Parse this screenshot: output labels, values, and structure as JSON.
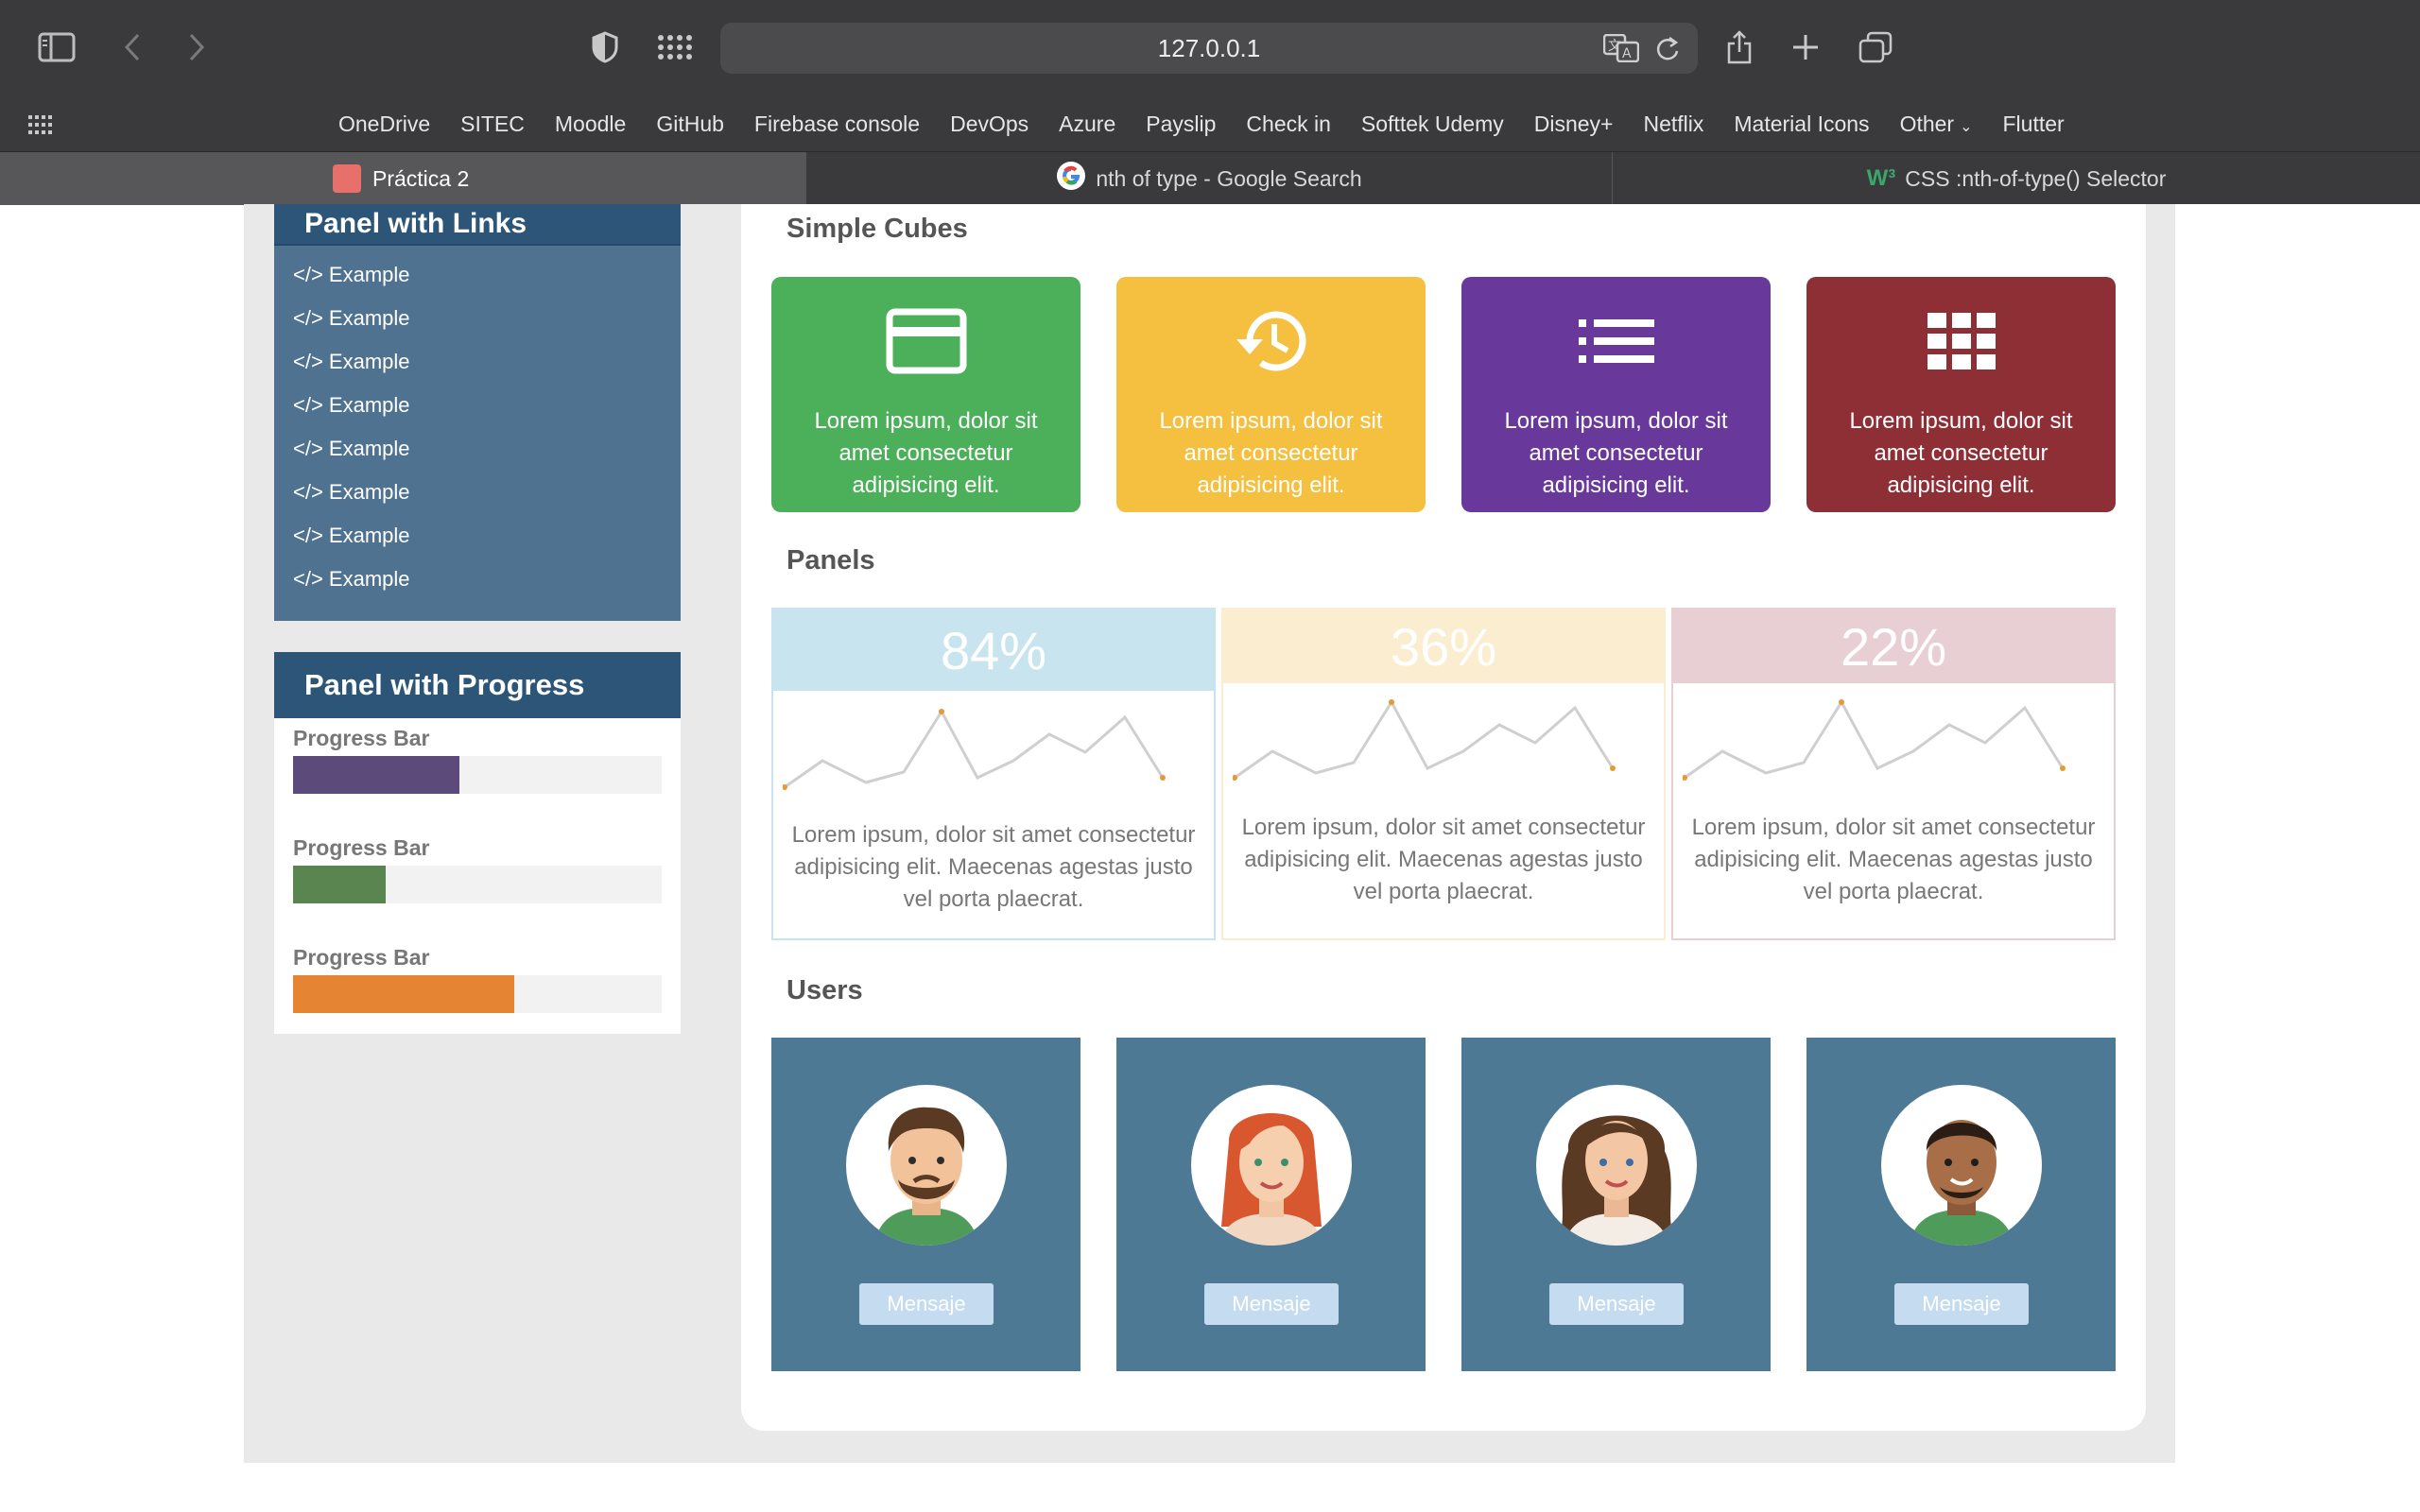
{
  "browser": {
    "url": "127.0.0.1",
    "bookmarks": [
      "OneDrive",
      "SITEC",
      "Moodle",
      "GitHub",
      "Firebase console",
      "DevOps",
      "Azure",
      "Payslip",
      "Check in",
      "Softtek Udemy",
      "Disney+",
      "Netflix",
      "Material Icons",
      "Other",
      "Flutter"
    ],
    "tabs": [
      {
        "title": "Práctica 2",
        "favicon_color": "#e8706a"
      },
      {
        "title": "nth of type - Google Search"
      },
      {
        "title": "CSS :nth-of-type() Selector"
      }
    ]
  },
  "sidebar": {
    "links_panel": {
      "title": "Panel with Links",
      "items": [
        "</> Example",
        "</> Example",
        "</> Example",
        "</> Example",
        "</> Example",
        "</> Example",
        "</> Example",
        "</> Example"
      ]
    },
    "progress_panel": {
      "title": "Panel with Progress",
      "bars": [
        {
          "label": "Progress Bar",
          "value": 0.45,
          "color": "#5c4a7a"
        },
        {
          "label": "Progress Bar",
          "value": 0.25,
          "color": "#5a8450"
        },
        {
          "label": "Progress Bar",
          "value": 0.6,
          "color": "#e58533"
        }
      ]
    }
  },
  "main": {
    "cubes_title": "Simple Cubes",
    "cubes": [
      {
        "icon": "credit-card-icon",
        "text": "Lorem ipsum, dolor sit amet consectetur adipisicing elit.",
        "color": "#4caf5a"
      },
      {
        "icon": "history-icon",
        "text": "Lorem ipsum, dolor sit amet consectetur adipisicing elit.",
        "color": "#f5bf3f"
      },
      {
        "icon": "list-icon",
        "text": "Lorem ipsum, dolor sit amet consectetur adipisicing elit.",
        "color": "#68399a"
      },
      {
        "icon": "apps-grid-icon",
        "text": "Lorem ipsum, dolor sit amet consectetur adipisicing elit.",
        "color": "#8e2f36"
      }
    ],
    "panels_title": "Panels",
    "panels": [
      {
        "value": "84%",
        "head_color": "#c8e5ef",
        "border_color": "#c8e5ef",
        "text": "Lorem ipsum, dolor sit amet consectetur adipisicing elit. Maecenas agestas justo vel porta plaecrat."
      },
      {
        "value": "36%",
        "head_color": "#fbeed0",
        "border_color": "#fbeed0",
        "text": "Lorem ipsum, dolor sit amet consectetur adipisicing elit. Maecenas agestas justo vel porta plaecrat."
      },
      {
        "value": "22%",
        "head_color": "#e8cfd3",
        "border_color": "#e8cfd3",
        "text": "Lorem ipsum, dolor sit amet consectetur adipisicing elit. Maecenas agestas justo vel porta plaecrat."
      }
    ],
    "users_title": "Users",
    "users": [
      {
        "button": "Mensaje"
      },
      {
        "button": "Mensaje"
      },
      {
        "button": "Mensaje"
      },
      {
        "button": "Mensaje"
      }
    ]
  }
}
